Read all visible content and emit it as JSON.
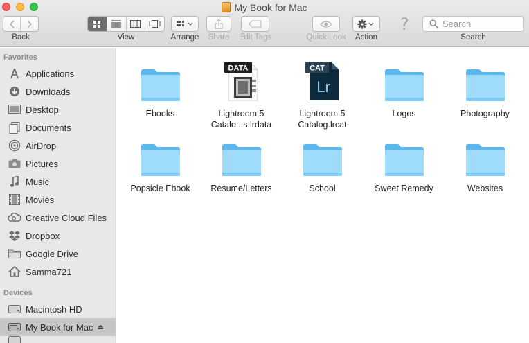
{
  "window": {
    "title": "My Book for Mac"
  },
  "toolbar": {
    "back_label": "Back",
    "view_label": "View",
    "arrange_label": "Arrange",
    "share_label": "Share",
    "edit_tags_label": "Edit Tags",
    "quick_look_label": "Quick Look",
    "action_label": "Action",
    "search_label": "Search",
    "search_placeholder": "Search",
    "help_glyph": "?",
    "view_modes": [
      "icon",
      "list",
      "column",
      "cover-flow"
    ],
    "active_view_mode": "icon"
  },
  "sidebar": {
    "favorites_header": "Favorites",
    "favorites": [
      {
        "label": "Applications",
        "icon": "applications-icon"
      },
      {
        "label": "Downloads",
        "icon": "downloads-icon"
      },
      {
        "label": "Desktop",
        "icon": "desktop-icon"
      },
      {
        "label": "Documents",
        "icon": "documents-icon"
      },
      {
        "label": "AirDrop",
        "icon": "airdrop-icon"
      },
      {
        "label": "Pictures",
        "icon": "pictures-icon"
      },
      {
        "label": "Music",
        "icon": "music-icon"
      },
      {
        "label": "Movies",
        "icon": "movies-icon"
      },
      {
        "label": "Creative Cloud Files",
        "icon": "creative-cloud-icon"
      },
      {
        "label": "Dropbox",
        "icon": "dropbox-icon"
      },
      {
        "label": "Google Drive",
        "icon": "folder-icon"
      },
      {
        "label": "Samma721",
        "icon": "home-icon"
      }
    ],
    "devices_header": "Devices",
    "devices": [
      {
        "label": "Macintosh HD",
        "icon": "hard-drive-icon"
      },
      {
        "label": "My Book for Mac",
        "icon": "external-drive-icon",
        "selected": true,
        "eject": "⏏"
      }
    ]
  },
  "files": [
    {
      "name": "Ebooks",
      "kind": "folder"
    },
    {
      "name": "Lightroom 5 Catalo...s.lrdata",
      "kind": "lrdata",
      "badge": "DATA"
    },
    {
      "name": "Lightroom 5 Catalog.lrcat",
      "kind": "lrcat",
      "badge": "CAT",
      "logo": "Lr"
    },
    {
      "name": "Logos",
      "kind": "folder"
    },
    {
      "name": "Photography",
      "kind": "folder"
    },
    {
      "name": "Popsicle Ebook",
      "kind": "folder"
    },
    {
      "name": "Resume/Letters",
      "kind": "folder"
    },
    {
      "name": "School",
      "kind": "folder"
    },
    {
      "name": "Sweet Remedy",
      "kind": "folder"
    },
    {
      "name": "Websites",
      "kind": "folder"
    }
  ],
  "colors": {
    "folder_light": "#9fdcfb",
    "folder_dark": "#5ab8ef",
    "lightroom_bg": "#0e2a3d",
    "lightroom_fg": "#8fd0f2",
    "selection": "#c6c6c6"
  }
}
